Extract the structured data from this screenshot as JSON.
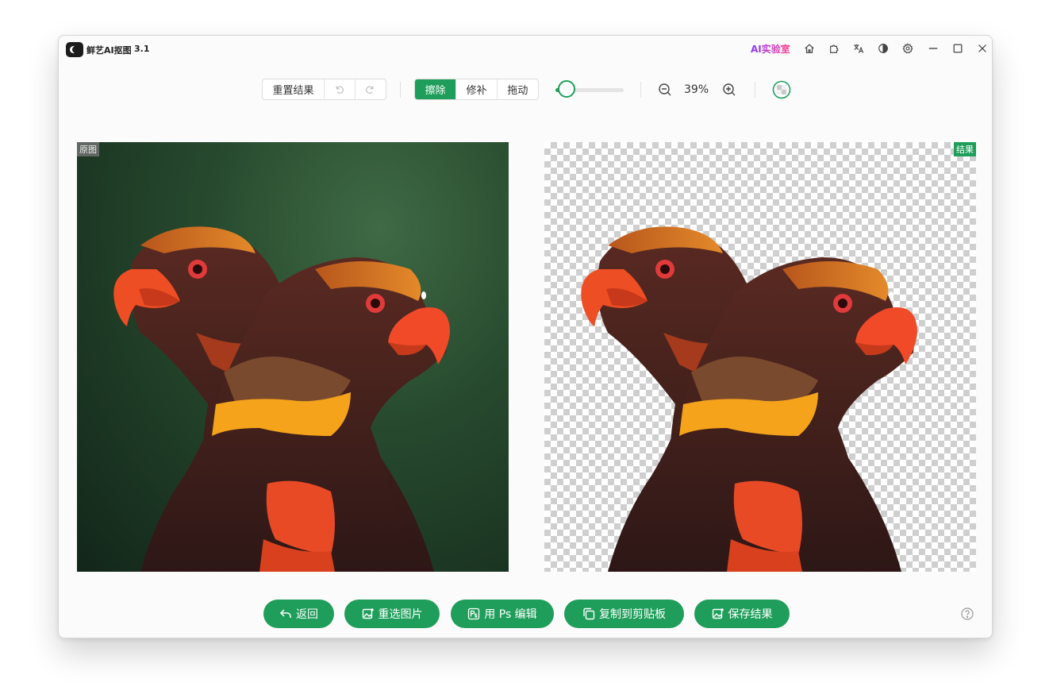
{
  "app": {
    "name": "鲜艺AI抠图",
    "version": "3.1",
    "ai_lab": "AI实验室"
  },
  "titlebar_icons": [
    "home-icon",
    "puzzle-icon",
    "translate-icon",
    "contrast-icon",
    "gear-icon",
    "minimize-icon",
    "maximize-icon",
    "close-icon"
  ],
  "toolbar": {
    "reset_label": "重置结果",
    "modes": [
      {
        "label": "擦除",
        "active": true
      },
      {
        "label": "修补",
        "active": false
      },
      {
        "label": "拖动",
        "active": false
      }
    ],
    "brush_size_fraction": 0.1,
    "zoom_value": "39%"
  },
  "panels": {
    "original_tag": "原图",
    "result_tag": "结果"
  },
  "actions": [
    {
      "label": "返回",
      "icon": "back-icon"
    },
    {
      "label": "重选图片",
      "icon": "image-add-icon"
    },
    {
      "label": "用 Ps 编辑",
      "icon": "ps-icon"
    },
    {
      "label": "复制到剪贴板",
      "icon": "copy-icon"
    },
    {
      "label": "保存结果",
      "icon": "image-save-icon"
    }
  ],
  "colors": {
    "accent": "#1e9e5a",
    "ai_lab": "#d43fd0"
  }
}
